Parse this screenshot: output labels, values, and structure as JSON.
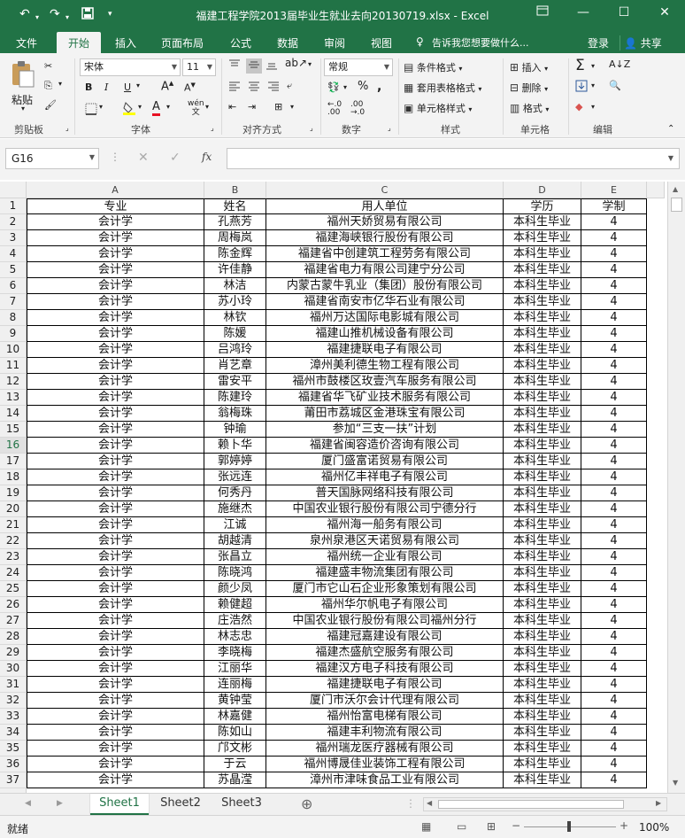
{
  "window": {
    "title": "福建工程学院2013届毕业生就业去向20130719.xlsx - Excel"
  },
  "menu": {
    "tabs": [
      "文件",
      "开始",
      "插入",
      "页面布局",
      "公式",
      "数据",
      "审阅",
      "视图"
    ],
    "tell_me": "告诉我您想要做什么...",
    "login": "登录",
    "share": "共享"
  },
  "ribbon": {
    "paste": "粘贴",
    "font_name": "宋体",
    "font_size": "11",
    "number_format": "常规",
    "conditional_format": "条件格式",
    "table_format": "套用表格格式",
    "cell_style": "单元格样式",
    "insert": "插入",
    "delete": "删除",
    "format": "格式",
    "groups": {
      "clipboard": "剪贴板",
      "font": "字体",
      "alignment": "对齐方式",
      "number": "数字",
      "styles": "样式",
      "cells": "单元格",
      "editing": "编辑"
    }
  },
  "formula_bar": {
    "name_box": "G16",
    "formula": ""
  },
  "columns": [
    "A",
    "B",
    "C",
    "D",
    "E"
  ],
  "rows": [
    [
      "专业",
      "姓名",
      "用人单位",
      "学历",
      "学制"
    ],
    [
      "会计学",
      "孔燕芳",
      "福州天娇贸易有限公司",
      "本科生毕业",
      "4"
    ],
    [
      "会计学",
      "周梅岚",
      "福建海峡银行股份有限公司",
      "本科生毕业",
      "4"
    ],
    [
      "会计学",
      "陈金辉",
      "福建省中创建筑工程劳务有限公司",
      "本科生毕业",
      "4"
    ],
    [
      "会计学",
      "许佳静",
      "福建省电力有限公司建宁分公司",
      "本科生毕业",
      "4"
    ],
    [
      "会计学",
      "林洁",
      "内蒙古蒙牛乳业（集团）股份有限公司",
      "本科生毕业",
      "4"
    ],
    [
      "会计学",
      "苏小玲",
      "福建省南安市亿华石业有限公司",
      "本科生毕业",
      "4"
    ],
    [
      "会计学",
      "林钦",
      "福州万达国际电影城有限公司",
      "本科生毕业",
      "4"
    ],
    [
      "会计学",
      "陈媛",
      "福建山推机械设备有限公司",
      "本科生毕业",
      "4"
    ],
    [
      "会计学",
      "吕鸿玲",
      "福建捷联电子有限公司",
      "本科生毕业",
      "4"
    ],
    [
      "会计学",
      "肖艺章",
      "漳州美利德生物工程有限公司",
      "本科生毕业",
      "4"
    ],
    [
      "会计学",
      "雷安平",
      "福州市鼓楼区玫壹汽车服务有限公司",
      "本科生毕业",
      "4"
    ],
    [
      "会计学",
      "陈建玲",
      "福建省华飞矿业技术服务有限公司",
      "本科生毕业",
      "4"
    ],
    [
      "会计学",
      "翁梅珠",
      "莆田市荔城区金港珠宝有限公司",
      "本科生毕业",
      "4"
    ],
    [
      "会计学",
      "钟瑜",
      "参加“三支一扶”计划",
      "本科生毕业",
      "4"
    ],
    [
      "会计学",
      "赖卜华",
      "福建省闽容造价咨询有限公司",
      "本科生毕业",
      "4"
    ],
    [
      "会计学",
      "郭婷婷",
      "厦门盛富诺贸易有限公司",
      "本科生毕业",
      "4"
    ],
    [
      "会计学",
      "张远连",
      "福州亿丰祥电子有限公司",
      "本科生毕业",
      "4"
    ],
    [
      "会计学",
      "何秀丹",
      "普天国脉网络科技有限公司",
      "本科生毕业",
      "4"
    ],
    [
      "会计学",
      "施继杰",
      "中国农业银行股份有限公司宁德分行",
      "本科生毕业",
      "4"
    ],
    [
      "会计学",
      "江诚",
      "福州海一船务有限公司",
      "本科生毕业",
      "4"
    ],
    [
      "会计学",
      "胡越清",
      "泉州泉港区天诺贸易有限公司",
      "本科生毕业",
      "4"
    ],
    [
      "会计学",
      "张昌立",
      "福州统一企业有限公司",
      "本科生毕业",
      "4"
    ],
    [
      "会计学",
      "陈晓鸿",
      "福建盛丰物流集团有限公司",
      "本科生毕业",
      "4"
    ],
    [
      "会计学",
      "颜少凤",
      "厦门市它山石企业形象策划有限公司",
      "本科生毕业",
      "4"
    ],
    [
      "会计学",
      "赖健超",
      "福州华尔帆电子有限公司",
      "本科生毕业",
      "4"
    ],
    [
      "会计学",
      "庄浩然",
      "中国农业银行股份有限公司福州分行",
      "本科生毕业",
      "4"
    ],
    [
      "会计学",
      "林志忠",
      "福建冠嘉建设有限公司",
      "本科生毕业",
      "4"
    ],
    [
      "会计学",
      "李晓梅",
      "福建杰盛航空服务有限公司",
      "本科生毕业",
      "4"
    ],
    [
      "会计学",
      "江丽华",
      "福建汉方电子科技有限公司",
      "本科生毕业",
      "4"
    ],
    [
      "会计学",
      "连丽梅",
      "福建捷联电子有限公司",
      "本科生毕业",
      "4"
    ],
    [
      "会计学",
      "黄钟莹",
      "厦门市沃尔会计代理有限公司",
      "本科生毕业",
      "4"
    ],
    [
      "会计学",
      "林嘉健",
      "福州怡富电梯有限公司",
      "本科生毕业",
      "4"
    ],
    [
      "会计学",
      "陈如山",
      "福建丰利物流有限公司",
      "本科生毕业",
      "4"
    ],
    [
      "会计学",
      "邝文彬",
      "福州瑞龙医疗器械有限公司",
      "本科生毕业",
      "4"
    ],
    [
      "会计学",
      "于云",
      "福州博晟佳业装饰工程有限公司",
      "本科生毕业",
      "4"
    ],
    [
      "会计学",
      "苏晶滢",
      "漳州市津味食品工业有限公司",
      "本科生毕业",
      "4"
    ]
  ],
  "sheets": [
    "Sheet1",
    "Sheet2",
    "Sheet3"
  ],
  "status": {
    "ready": "就绪",
    "zoom": "100%"
  },
  "colors": {
    "excel_green": "#217346"
  }
}
